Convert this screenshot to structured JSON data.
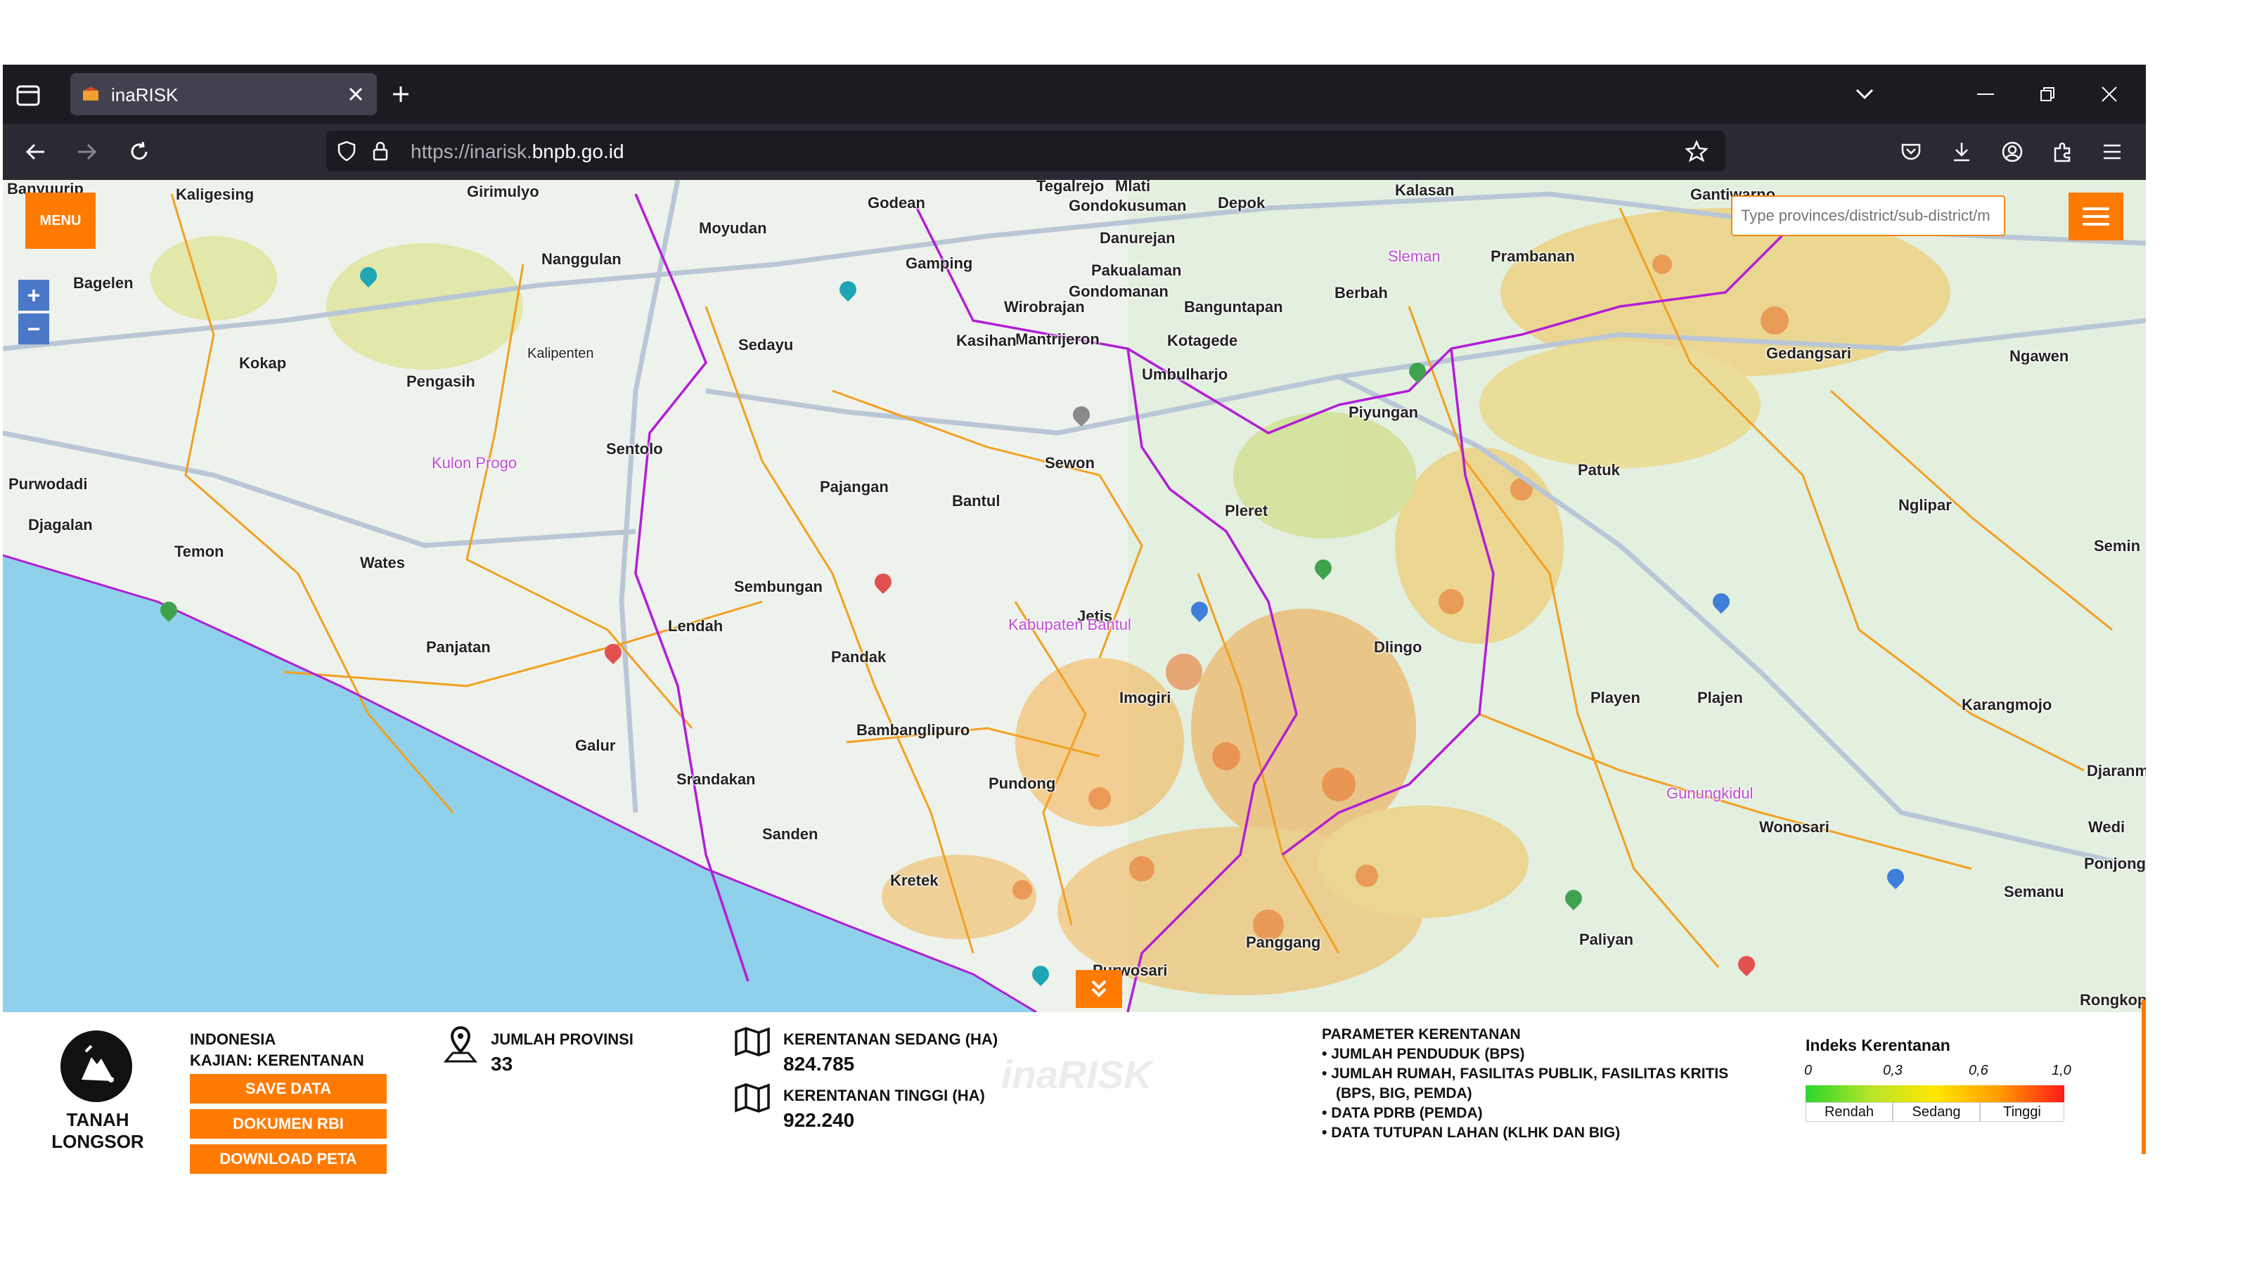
{
  "browser": {
    "tab_title": "inaRISK",
    "url_prefix": "https://inarisk.",
    "url_domain": "bnpb.go.id"
  },
  "map": {
    "menu_label": "MENU",
    "zoom_in": "+",
    "zoom_out": "−",
    "search_placeholder": "Type provinces/district/sub-district/m",
    "places": [
      "Banyuurip",
      "Kaligesing",
      "Girimulyo",
      "Moyudan",
      "Godean",
      "Tegalrejo",
      "Mlati",
      "Gondokusuman",
      "Depok",
      "Kalasan",
      "Gantiwarno",
      "Bagelen",
      "Nanggulan",
      "Gamping",
      "Danurejan",
      "Pakualaman",
      "Gondomanan",
      "Wirobrajan",
      "Mantrijeron",
      "Kasihan",
      "Kotagede",
      "Banguntapan",
      "Berbah",
      "Prambanan",
      "Kokap",
      "Sedayu",
      "Umbulharjo",
      "Gedangsari",
      "Ngawen",
      "Pengasih",
      "Kalipenten",
      "Sewon",
      "Piyungan",
      "Sentolo",
      "Pajangan",
      "Bantul",
      "Pleret",
      "Patuk",
      "Nglipar",
      "Purwodadi",
      "Temon",
      "Wates",
      "Jetis",
      "Dlingo",
      "Semin",
      "Djagalan",
      "Lendah",
      "Imogiri",
      "Panjatan",
      "Pandak",
      "Playen",
      "Plajen",
      "Karangmojo",
      "Galur",
      "Bambanglipuro",
      "Sembungan",
      "Srandakan",
      "Pundong",
      "Wonosari",
      "Sanden",
      "Kretek",
      "Djaranma",
      "Ponjong",
      "Panggang",
      "Paliyan",
      "Purwosari",
      "Semanu",
      "Rongkop",
      "Wedi",
      "Kulon Progo",
      "Sleman",
      "Gunungkidul",
      "Kabupaten Bantul"
    ]
  },
  "panel": {
    "hazard_name": "TANAH LONGSOR",
    "region": "INDONESIA",
    "study": "KAJIAN: KERENTANAN",
    "btn_save": "SAVE DATA",
    "btn_rbi": "DOKUMEN RBI",
    "btn_map": "DOWNLOAD PETA",
    "provinces_label": "JUMLAH PROVINSI",
    "provinces_value": "33",
    "medium_label": "KERENTANAN SEDANG (HA)",
    "medium_value": "824.785",
    "high_label": "KERENTANAN TINGGI (HA)",
    "high_value": "922.240",
    "params_title": "PARAMETER KERENTANAN",
    "params": [
      "JUMLAH PENDUDUK (BPS)",
      "JUMLAH RUMAH, FASILITAS PUBLIK, FASILITAS KRITIS",
      "(BPS, BIG, PEMDA)",
      "DATA PDRB (PEMDA)",
      "DATA TUTUPAN LAHAN (KLHK DAN BIG)"
    ],
    "legend_title": "Indeks Kerentanan",
    "legend_ticks": [
      "0",
      "0,3",
      "0,6",
      "1,0"
    ],
    "legend_classes": [
      "Rendah",
      "Sedang",
      "Tinggi"
    ],
    "watermark": "inaRISK"
  }
}
